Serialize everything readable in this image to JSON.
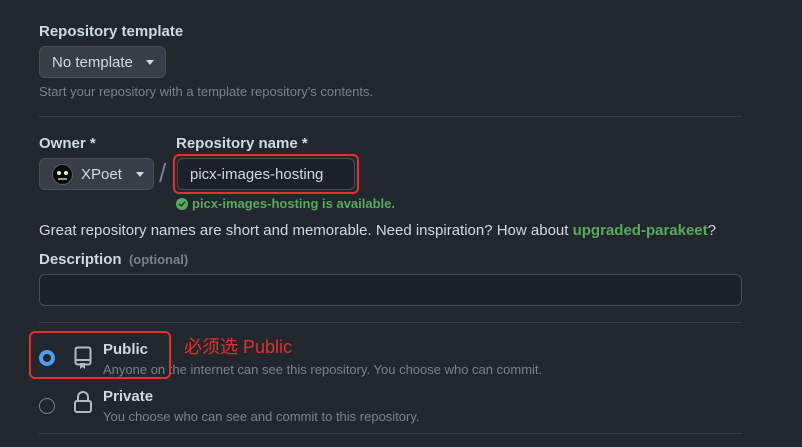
{
  "template": {
    "label": "Repository template",
    "button": "No template",
    "hint": "Start your repository with a template repository's contents."
  },
  "owner": {
    "label": "Owner *",
    "name": "XPoet"
  },
  "separator": "/",
  "repo": {
    "label": "Repository name *",
    "value": "picx-images-hosting",
    "available": "picx-images-hosting is available."
  },
  "inspiration": {
    "text": "Great repository names are short and memorable. Need inspiration? How about ",
    "suggestion": "upgraded-parakeet",
    "suffix": "?"
  },
  "description": {
    "label": "Description",
    "optional": "(optional)",
    "value": ""
  },
  "visibility": {
    "public": {
      "title": "Public",
      "desc": "Anyone on the internet can see this repository. You choose who can commit.",
      "selected": true
    },
    "private": {
      "title": "Private",
      "desc": "You choose who can see and commit to this repository.",
      "selected": false
    }
  },
  "annotation": "必须选 Public",
  "colors": {
    "accent": "#539bf5",
    "success": "#57ab5a",
    "annotation": "#e5302a"
  },
  "icons": {
    "dropdown": "triangle-down-icon",
    "available": "check-circle-fill-icon",
    "public": "repo-icon",
    "private": "lock-icon"
  }
}
